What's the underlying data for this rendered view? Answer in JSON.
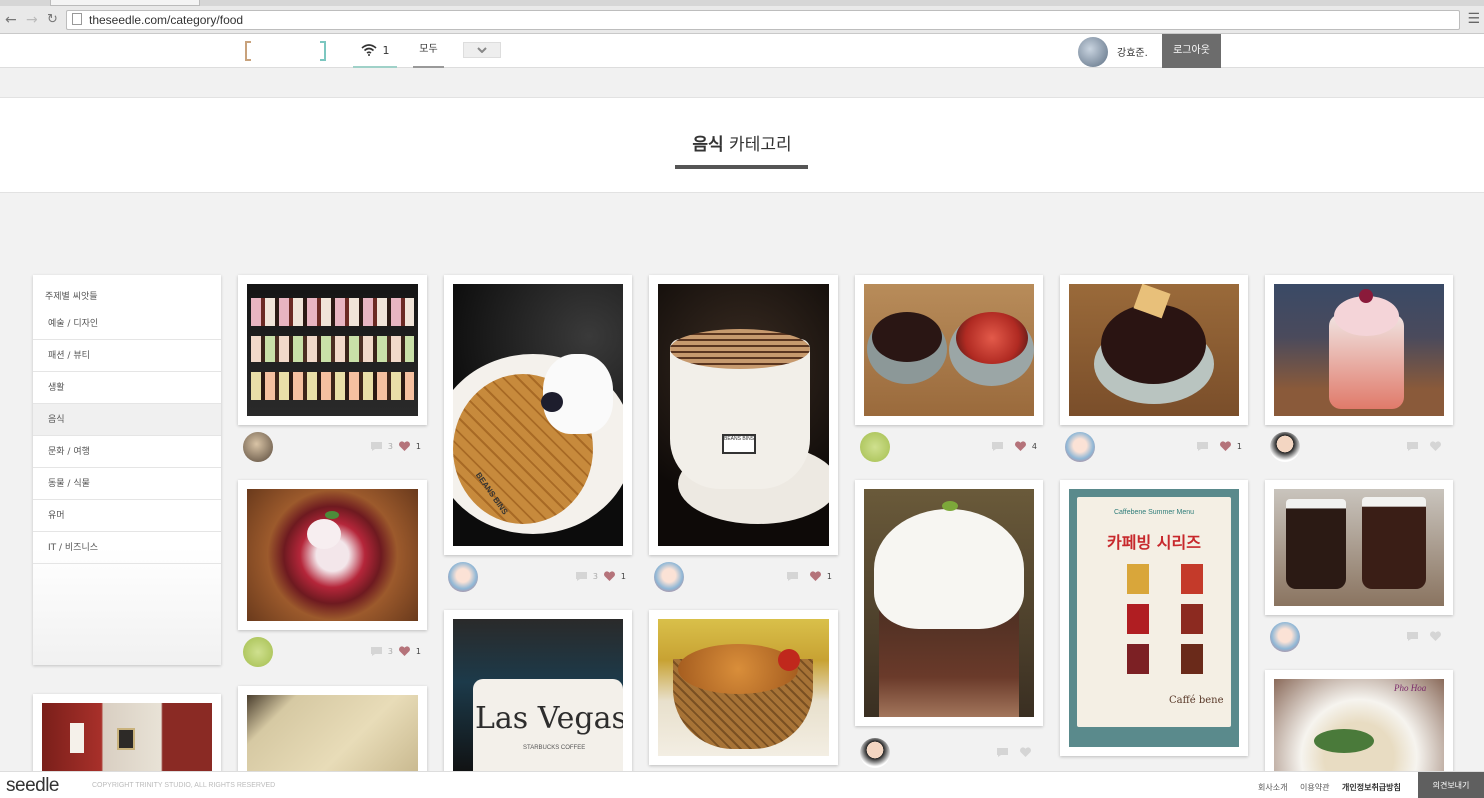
{
  "browser": {
    "url": "theseedle.com/category/food",
    "back": "←",
    "forward": "→",
    "reload": "C",
    "menu": "☰"
  },
  "header": {
    "feed_count": "1",
    "all_tab": "모두",
    "username": "강효준.",
    "logout": "로그아웃"
  },
  "banner": {
    "title_strong": "음식",
    "title_rest": " 카테고리"
  },
  "sidebar": {
    "title": "주제별 씨앗들",
    "items": [
      {
        "label": "예술 / 디자인"
      },
      {
        "label": "패션 / 뷰티"
      },
      {
        "label": "생활"
      },
      {
        "label": "음식"
      },
      {
        "label": "문화 / 여행"
      },
      {
        "label": "동물 / 식물"
      },
      {
        "label": "유머"
      },
      {
        "label": "IT / 비즈니스"
      }
    ]
  },
  "posts": [
    {
      "comments": "3",
      "likes": "1"
    },
    {
      "comments": "3",
      "likes": "1"
    },
    {
      "comments": "",
      "likes": "1"
    },
    {
      "comments": "",
      "likes": "4"
    },
    {
      "comments": "",
      "likes": "1"
    },
    {
      "comments": "",
      "likes": ""
    },
    {
      "comments": "3",
      "likes": "1"
    },
    {
      "comments": "",
      "likes": ""
    },
    {
      "comments": "",
      "likes": ""
    }
  ],
  "photos": {
    "cupcake_case": "cupcakes in display case",
    "waffle": "BEANS BINS",
    "coffee": "BEANS BINS",
    "mug": "Las Vegas",
    "mug_sub": "STARBUCKS COFFEE",
    "menu_title": "Caffebene Summer Menu",
    "menu_big": "카페빙 시리즈",
    "menu_brand": "Caffé bene",
    "noodle_sign": "Pho Hoa"
  },
  "footer": {
    "logo": "seedle",
    "copyright": "COPYRIGHT TRINITY STUDIO, ALL RIGHTS RESERVED",
    "links": [
      "회사소개",
      "이용약관",
      "개인정보취급방침"
    ],
    "feedback": "의견보내기"
  }
}
